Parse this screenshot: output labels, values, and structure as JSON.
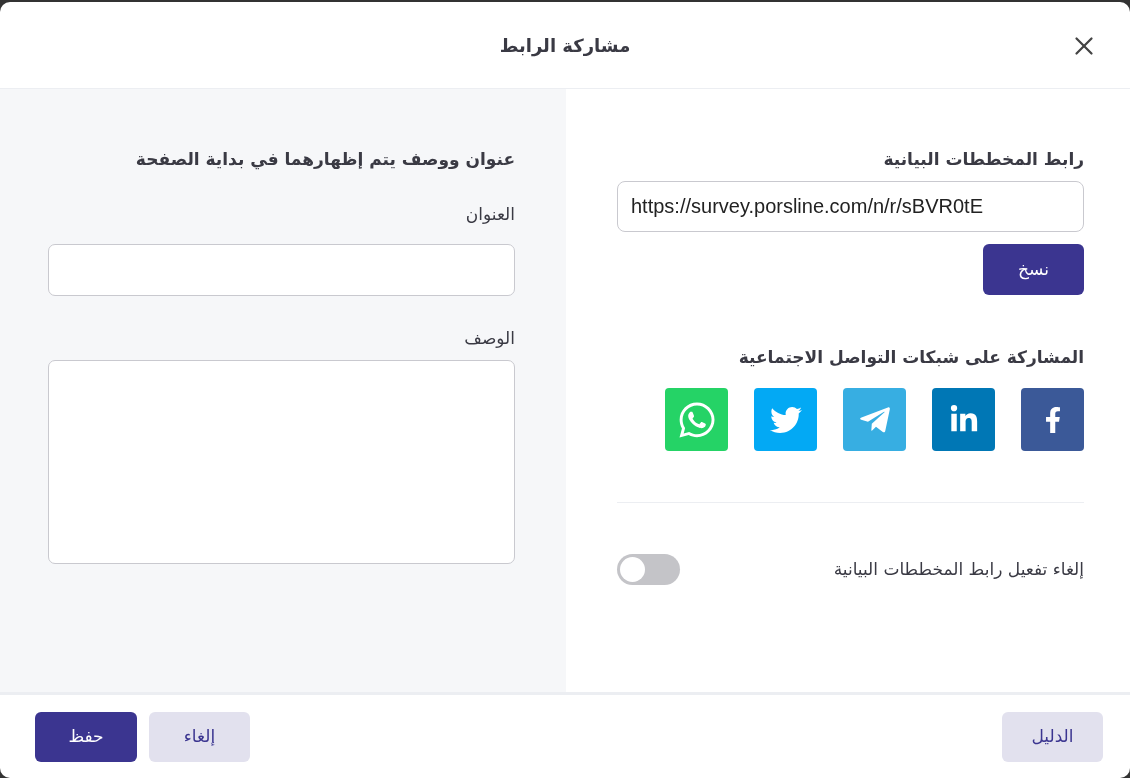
{
  "dialog": {
    "title": "مشاركة الرابط"
  },
  "link_section": {
    "heading": "رابط المخططات البيانية",
    "url": "https://survey.porsline.com/n/r/sBVR0tE",
    "copy_button": "نسخ"
  },
  "social": {
    "heading": "المشاركة على شبكات التواصل الاجتماعية",
    "networks": [
      {
        "kind": "facebook",
        "color": "#3b5998"
      },
      {
        "kind": "linkedin",
        "color": "#0077b5"
      },
      {
        "kind": "telegram",
        "color": "#37aee2"
      },
      {
        "kind": "twitter",
        "color": "#03a9f4"
      },
      {
        "kind": "whatsapp",
        "color": "#25d366"
      }
    ]
  },
  "deactivate": {
    "label": "إلغاء تفعيل رابط المخططات البيانية",
    "on": false
  },
  "page_header": {
    "heading": "عنوان ووصف يتم إظهارهما في بداية الصفحة",
    "fields": [
      {
        "label": "العنوان",
        "kind": "input"
      },
      {
        "label": "الوصف",
        "kind": "textarea"
      }
    ]
  },
  "footer": {
    "guide": "الدليل",
    "cancel": "إلغاء",
    "save": "حفظ"
  }
}
